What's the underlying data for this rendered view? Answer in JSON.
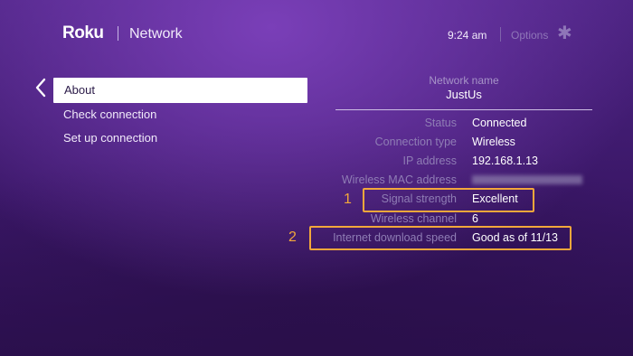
{
  "header": {
    "logo": "Roku",
    "title": "Network",
    "clock": "9:24  am",
    "options_label": "Options",
    "options_icon": "asterisk-icon"
  },
  "menu": {
    "items": [
      {
        "label": "About",
        "selected": true
      },
      {
        "label": "Check connection",
        "selected": false
      },
      {
        "label": "Set up connection",
        "selected": false
      }
    ]
  },
  "network": {
    "name_label": "Network name",
    "name_value": "JustUs"
  },
  "details": [
    {
      "label": "Status",
      "value": "Connected"
    },
    {
      "label": "Connection type",
      "value": "Wireless"
    },
    {
      "label": "IP address",
      "value": "192.168.1.13"
    },
    {
      "label": "Wireless MAC address",
      "value": ""
    },
    {
      "label": "Signal strength",
      "value": "Excellent"
    },
    {
      "label": "Wireless channel",
      "value": "6"
    },
    {
      "label": "Internet download speed",
      "value": "Good as of 11/13"
    }
  ],
  "annotations": {
    "marker_1": "1",
    "marker_2": "2",
    "color": "#f2a73b"
  }
}
